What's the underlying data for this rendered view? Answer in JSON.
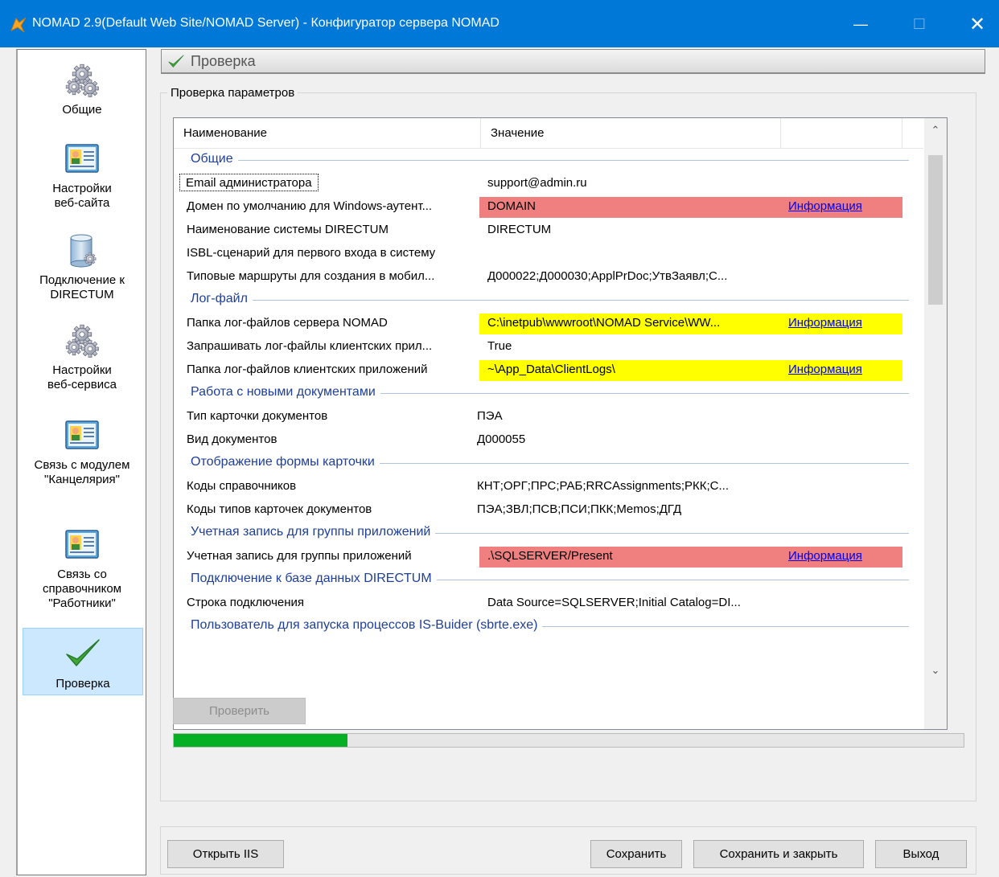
{
  "window": {
    "title": "NOMAD 2.9(Default Web Site/NOMAD Server) - Конфигуратор сервера NOMAD",
    "minimize_glyph": "—",
    "maximize_glyph": "☐",
    "close_glyph": "✕"
  },
  "sidebar": {
    "items": [
      {
        "label": "Общие",
        "icon": "gears-icon"
      },
      {
        "label": "Настройки\nвеб-сайта",
        "icon": "contact-card-icon"
      },
      {
        "label": "Подключение к\nDIRECTUM",
        "icon": "database-icon"
      },
      {
        "label": "Настройки\nвеб-сервиса",
        "icon": "gears-icon"
      },
      {
        "label": "Связь с модулем\n\"Канцелярия\"",
        "icon": "contact-card-icon"
      },
      {
        "label": "Связь со\nсправочником\n\"Работники\"",
        "icon": "contact-card-icon"
      },
      {
        "label": "Проверка",
        "icon": "checkmark-icon"
      }
    ],
    "active_index": 6
  },
  "header": {
    "title": "Проверка"
  },
  "check_group": {
    "legend": "Проверка параметров",
    "columns": [
      "Наименование",
      "Значение",
      ""
    ],
    "groups": [
      {
        "label": "Общие",
        "rows": [
          {
            "name": "Email администратора",
            "value": "support@admin.ru",
            "status": "none",
            "info": ""
          },
          {
            "name": "Домен по умолчанию для Windows-аутент...",
            "value": "DOMAIN",
            "status": "error",
            "info": "Информация"
          },
          {
            "name": "Наименование системы DIRECTUM",
            "value": "DIRECTUM",
            "status": "none",
            "info": ""
          },
          {
            "name": "ISBL-сценарий для первого входа в систему",
            "value": "",
            "status": "none",
            "info": ""
          },
          {
            "name": "Типовые маршруты для создания в мобил...",
            "value": "Д000022;Д000030;ApplPrDoc;УтвЗаявл;С...",
            "status": "none",
            "info": ""
          }
        ]
      },
      {
        "label": "Лог-файл",
        "rows": [
          {
            "name": "Папка лог-файлов сервера NOMAD",
            "value": "C:\\inetpub\\wwwroot\\NOMAD Service\\WW...",
            "status": "warning",
            "info": "Информация"
          },
          {
            "name": "Запрашивать лог-файлы клиентских прил...",
            "value": "True",
            "status": "none",
            "info": ""
          },
          {
            "name": "Папка лог-файлов клиентских приложений",
            "value": "~\\App_Data\\ClientLogs\\",
            "status": "warning",
            "info": "Информация"
          }
        ]
      },
      {
        "label": "Работа с новыми документами",
        "rows": [
          {
            "name": "Тип карточки документов",
            "value": "ПЭА",
            "status": "none",
            "info": ""
          },
          {
            "name": "Вид документов",
            "value": "Д000055",
            "status": "none",
            "info": ""
          }
        ]
      },
      {
        "label": "Отображение формы карточки",
        "rows": [
          {
            "name": "Коды справочников",
            "value": "КНТ;ОРГ;ПРС;РАБ;RRCAssignments;РКК;С...",
            "status": "none",
            "info": ""
          },
          {
            "name": "Коды типов карточек документов",
            "value": "ПЭА;ЗВЛ;ПСВ;ПСИ;ПКК;Memos;ДГД",
            "status": "none",
            "info": ""
          }
        ]
      },
      {
        "label": "Учетная запись для группы приложений",
        "rows": [
          {
            "name": "Учетная запись для группы приложений",
            "value": ".\\SQLSERVER/Present",
            "status": "error",
            "info": "Информация"
          }
        ]
      },
      {
        "label": "Подключение к базе данных DIRECTUM",
        "rows": [
          {
            "name": "Строка подключения",
            "value": "Data Source=SQLSERVER;Initial Catalog=DI...",
            "status": "none",
            "info": ""
          }
        ]
      },
      {
        "label": "Пользователь для запуска процессов IS-Buider (sbrte.exe)",
        "rows": []
      }
    ],
    "check_button": "Проверить",
    "progress": 0.22
  },
  "footer": {
    "open_iis": "Открыть IIS",
    "save": "Сохранить",
    "save_close": "Сохранить и закрыть",
    "exit": "Выход"
  },
  "colors": {
    "error": "#f08080",
    "warning": "#ffff00",
    "link": "#0000ee",
    "group_label": "#1e3f99",
    "progress": "#06b025",
    "title_bar": "#0078d7"
  }
}
